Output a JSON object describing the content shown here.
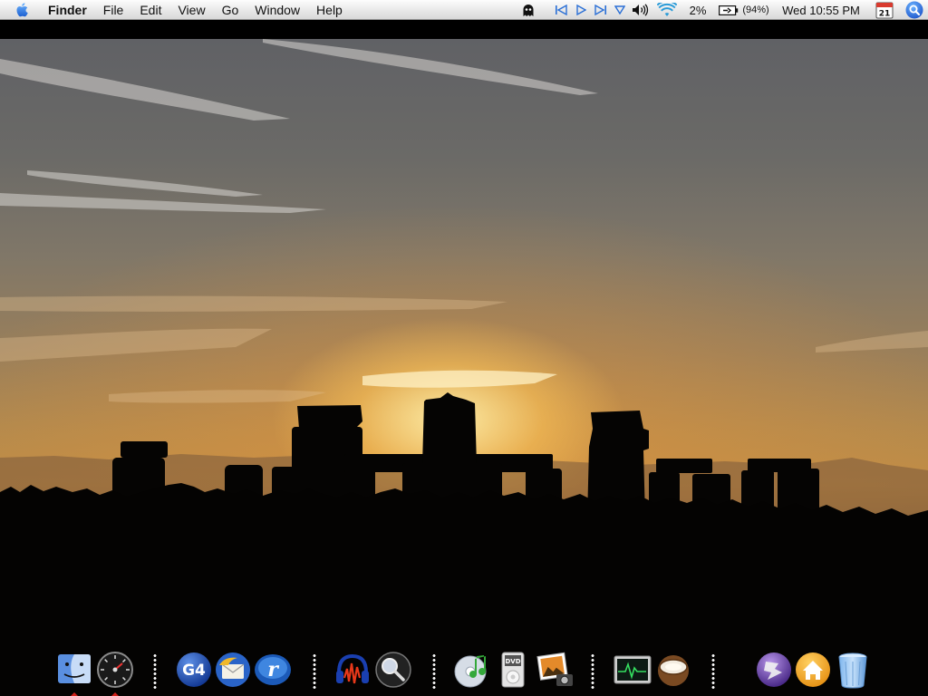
{
  "menubar": {
    "apple_icon": "apple-icon",
    "app_name": "Finder",
    "menus": [
      "File",
      "Edit",
      "View",
      "Go",
      "Window",
      "Help"
    ],
    "status": {
      "ghost_icon": "ghost-icon",
      "media_controls": [
        "previous-track-icon",
        "play-icon",
        "next-track-icon",
        "dropdown-icon"
      ],
      "volume_icon": "volume-icon",
      "wifi_icon": "wifi-icon",
      "cpu_usage": "2%",
      "battery_icon": "battery-icon",
      "battery_percent": "(94%)",
      "clock": "Wed 10:55 PM",
      "calendar_day": "21",
      "spotlight_icon": "spotlight-icon"
    }
  },
  "desktop": {
    "wallpaper": "stonehenge-sunset"
  },
  "dock": {
    "items": [
      {
        "name": "finder",
        "running": true
      },
      {
        "name": "dashboard",
        "running": true
      },
      {
        "name": "g4-system",
        "label": "G4",
        "running": false
      },
      {
        "name": "thunderbird",
        "running": false
      },
      {
        "name": "realplayer",
        "running": false
      },
      {
        "name": "audacity",
        "running": false
      },
      {
        "name": "search-lens",
        "running": false
      },
      {
        "name": "itunes",
        "running": false
      },
      {
        "name": "dvd-player",
        "label": "DVD",
        "running": false
      },
      {
        "name": "iphoto",
        "running": false
      },
      {
        "name": "activity-monitor",
        "running": false
      },
      {
        "name": "coconutbattery",
        "running": false
      },
      {
        "name": "quicksilver",
        "running": false
      },
      {
        "name": "home",
        "running": false
      },
      {
        "name": "trash",
        "running": false
      }
    ]
  }
}
